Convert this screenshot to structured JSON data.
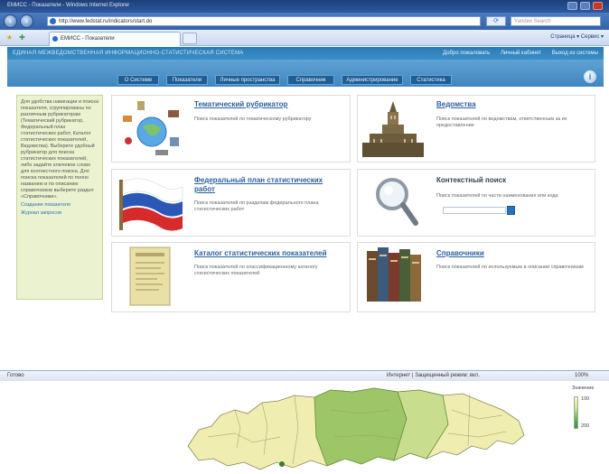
{
  "browser": {
    "window_title": "ЕМИСС - Показатели - Windows Internet Explorer",
    "url": "http://www.fedstat.ru/indicators/start.do",
    "search_placeholder": "Yandex Search",
    "tab_label": "ЕМИСС - Показатели",
    "cmd_bar": "Страница ▾  Сервис ▾"
  },
  "site": {
    "name": "ЕДИНАЯ МЕЖВЕДОМСТВЕННАЯ ИНФОРМАЦИОННО-СТАТИСТИЧЕСКАЯ СИСТЕМА",
    "header_links": [
      "Добро пожаловать",
      "Личный кабинет",
      "Выход из системы"
    ],
    "menu": [
      "О Системе",
      "Показатели",
      "Личные пространства",
      "Справочник",
      "Администрирование",
      "Статистика"
    ]
  },
  "sidebar": {
    "text": "Для удобства навигации и поиска показателя, сгруппированы по различным рубрикаторам (Тематический рубрикатор, Федеральный план статистических работ, Каталог статистических показателей, Ведомства). Выберите удобный рубрикатор для поиска статистических показателей, либо задайте ключевое слово для контекстного поиска. Для поиска показателей по полно названию и по описанию справочников выберите раздел «Справочники».",
    "link1": "Создание показателя",
    "link2": "Журнал запросов"
  },
  "cards": {
    "thematic": {
      "title": "Тематический рубрикатор",
      "desc": "Поиск показателей по тематическому рубрикатору"
    },
    "agencies": {
      "title": "Ведомства",
      "desc": "Поиск показателей по ведомствам, ответственным за их предоставление"
    },
    "fedplan": {
      "title": "Федеральный план статистических работ",
      "desc": "Поиск показателей по разделам федерального плана статистических работ"
    },
    "context": {
      "title": "Контекстный поиск",
      "desc": "Поиск показателей по части наименования или кода"
    },
    "catalog": {
      "title": "Каталог статистических показателей",
      "desc": "Поиск показателей по классификационному каталогу статистических показателей"
    },
    "refs": {
      "title": "Справочники",
      "desc": "Поиск показателей по используемым в описании справочникам"
    }
  },
  "status": {
    "left": "Готово",
    "mid": "Интернет | Защищенный режим: вкл.",
    "zoom": "100%"
  },
  "map_legend": {
    "title": "Значение",
    "max": "100",
    "min": "200"
  },
  "colors": {
    "accent": "#2a7bb7",
    "menu_button": "#1e5d95",
    "sidebar_bg": "#eaf2cf",
    "map_light": "#efedb0",
    "map_green": "#9dc767"
  }
}
